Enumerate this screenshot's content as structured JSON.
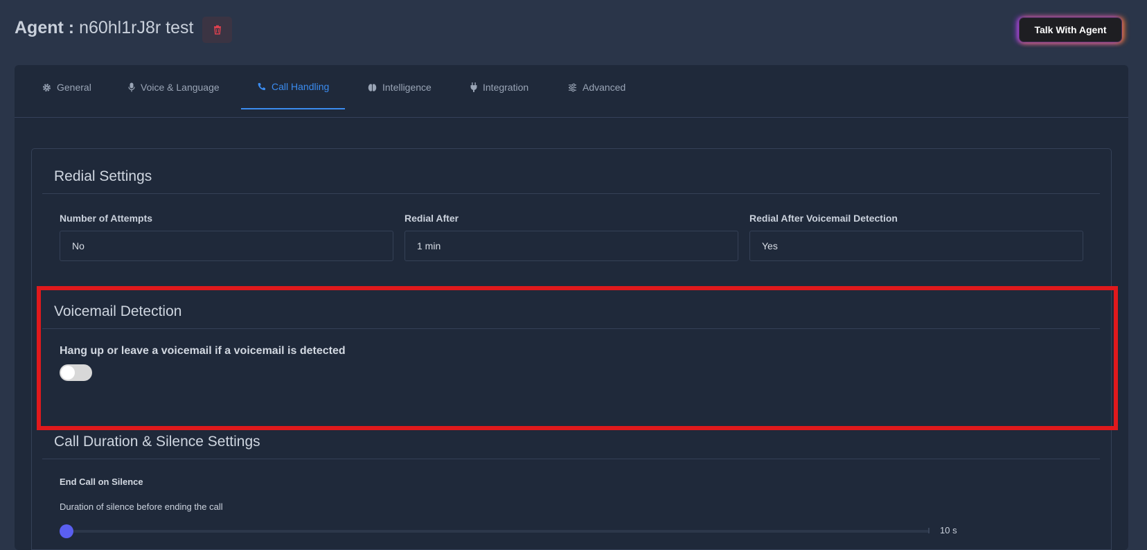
{
  "header": {
    "title_prefix": "Agent :",
    "agent_name": "n60hl1rJ8r test",
    "talk_button": "Talk With Agent"
  },
  "tabs": [
    {
      "label": "General",
      "icon": "gear-icon"
    },
    {
      "label": "Voice & Language",
      "icon": "microphone-icon"
    },
    {
      "label": "Call Handling",
      "icon": "phone-icon",
      "active": true
    },
    {
      "label": "Intelligence",
      "icon": "brain-icon"
    },
    {
      "label": "Integration",
      "icon": "plug-icon"
    },
    {
      "label": "Advanced",
      "icon": "sliders-icon"
    }
  ],
  "redial": {
    "title": "Redial Settings",
    "fields": [
      {
        "label": "Number of Attempts",
        "value": "No"
      },
      {
        "label": "Redial After",
        "value": "1 min"
      },
      {
        "label": "Redial After Voicemail Detection",
        "value": "Yes"
      }
    ]
  },
  "voicemail": {
    "title": "Voicemail Detection",
    "toggle_label": "Hang up or leave a voicemail if a voicemail is detected",
    "toggle_on": false
  },
  "duration": {
    "title": "Call Duration & Silence Settings",
    "end_call_label": "End Call on Silence",
    "silence_desc": "Duration of silence before ending the call",
    "slider_value": "10 s",
    "slider_fraction": 0
  },
  "colors": {
    "accent": "#3b8cf0",
    "highlight": "#e0191c",
    "slider_thumb": "#5a5ff0",
    "delete_icon": "#e0414f"
  }
}
